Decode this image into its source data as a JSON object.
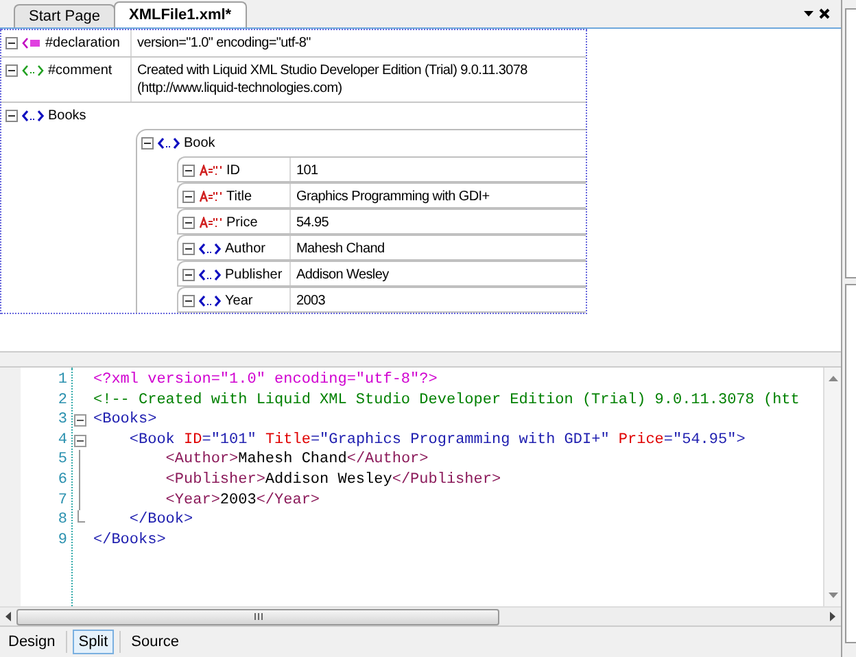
{
  "tabs": [
    {
      "label": "Start Page",
      "selected": false
    },
    {
      "label": "XMLFile1.xml*",
      "selected": true
    }
  ],
  "grid": {
    "nodes": [
      {
        "kind": "declaration",
        "name": "#declaration",
        "value": "version=\"1.0\" encoding=\"utf-8\"",
        "expanded": true
      },
      {
        "kind": "comment",
        "name": "#comment",
        "value": "Created with Liquid XML Studio Developer Edition (Trial) 9.0.11.3078\n(http://www.liquid-technologies.com)",
        "expanded": true
      },
      {
        "kind": "element",
        "name": "Books",
        "expanded": true,
        "children": [
          {
            "kind": "element",
            "name": "Book",
            "expanded": true,
            "children": [
              {
                "kind": "attribute",
                "name": "ID",
                "value": "101",
                "expanded": true
              },
              {
                "kind": "attribute",
                "name": "Title",
                "value": "Graphics Programming with GDI+",
                "expanded": true
              },
              {
                "kind": "attribute",
                "name": "Price",
                "value": "54.95",
                "expanded": true
              },
              {
                "kind": "element",
                "name": "Author",
                "value": "Mahesh Chand",
                "expanded": true
              },
              {
                "kind": "element",
                "name": "Publisher",
                "value": "Addison Wesley",
                "expanded": true
              },
              {
                "kind": "element",
                "name": "Year",
                "value": "2003",
                "expanded": true
              }
            ]
          }
        ]
      }
    ]
  },
  "code": [
    {
      "number": "1",
      "kind": "plain",
      "tokens": [
        {
          "kind": "pi",
          "text": "<?xml version=\"1.0\" encoding=\"utf-8\"?>"
        }
      ]
    },
    {
      "number": "2",
      "kind": "plain",
      "tokens": [
        {
          "kind": "comment",
          "text": "<!-- Created with Liquid XML Studio Developer Edition (Trial) 9.0.11.3078 (htt"
        }
      ]
    },
    {
      "number": "3",
      "kind": "foldstart",
      "tokens": [
        {
          "kind": "tag",
          "text": "<Books>"
        }
      ]
    },
    {
      "number": "4",
      "kind": "foldstart",
      "tokens": [
        {
          "kind": "tag",
          "text": "    <Book "
        },
        {
          "kind": "attr",
          "text": "ID"
        },
        {
          "kind": "tag",
          "text": "=\"101\" "
        },
        {
          "kind": "attr",
          "text": "Title"
        },
        {
          "kind": "tag",
          "text": "=\"Graphics Programming with GDI+\" "
        },
        {
          "kind": "attr",
          "text": "Price"
        },
        {
          "kind": "tag",
          "text": "=\"54.95\">"
        }
      ]
    },
    {
      "number": "5",
      "kind": "foldbody",
      "tokens": [
        {
          "kind": "tag2",
          "text": "        <Author>"
        },
        {
          "kind": "text",
          "text": "Mahesh Chand"
        },
        {
          "kind": "tag2",
          "text": "</Author>"
        }
      ]
    },
    {
      "number": "6",
      "kind": "foldbody",
      "tokens": [
        {
          "kind": "tag2",
          "text": "        <Publisher>"
        },
        {
          "kind": "text",
          "text": "Addison Wesley"
        },
        {
          "kind": "tag2",
          "text": "</Publisher>"
        }
      ]
    },
    {
      "number": "7",
      "kind": "foldbody",
      "tokens": [
        {
          "kind": "tag2",
          "text": "        <Year>"
        },
        {
          "kind": "text",
          "text": "2003"
        },
        {
          "kind": "tag2",
          "text": "</Year>"
        }
      ]
    },
    {
      "number": "8",
      "kind": "foldend",
      "tokens": [
        {
          "kind": "tag",
          "text": "    </Book>"
        }
      ]
    },
    {
      "number": "9",
      "kind": "plain",
      "tokens": [
        {
          "kind": "tag",
          "text": "</Books>"
        }
      ]
    }
  ],
  "view_tabs": [
    {
      "label": "Design",
      "selected": false
    },
    {
      "label": "Split",
      "selected": true
    },
    {
      "label": "Source",
      "selected": false
    }
  ]
}
